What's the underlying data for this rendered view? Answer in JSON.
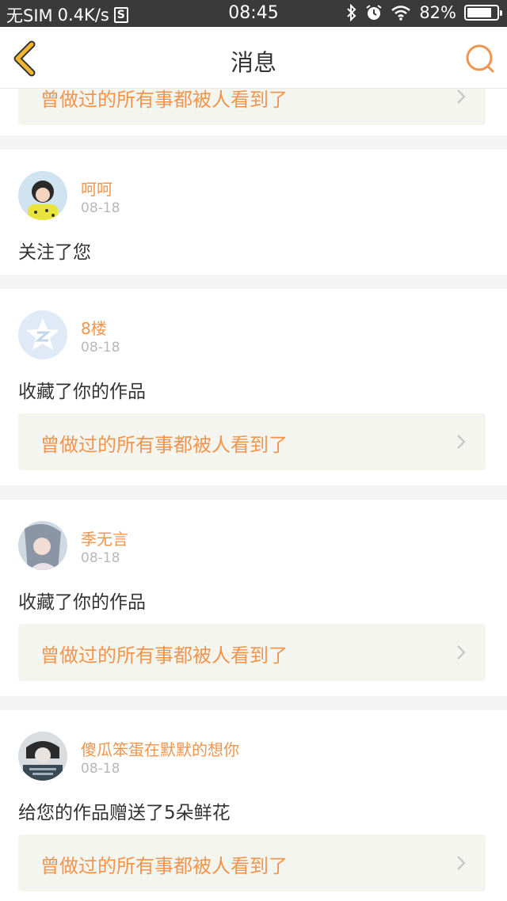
{
  "status_bar": {
    "carrier": "无SIM",
    "speed": "0.4K/s",
    "sim_icon": "S",
    "time": "08:45",
    "battery": "82%",
    "battery_level": 0.82
  },
  "nav": {
    "title": "消息"
  },
  "notifications": [
    {
      "link_text": "曾做过的所有事都被人看到了"
    },
    {
      "user": "呵呵",
      "date": "08-18",
      "action": "关注了您"
    },
    {
      "user": "8楼",
      "date": "08-18",
      "action": "收藏了你的作品",
      "link_text": "曾做过的所有事都被人看到了"
    },
    {
      "user": "季无言",
      "date": "08-18",
      "action": "收藏了你的作品",
      "link_text": "曾做过的所有事都被人看到了"
    },
    {
      "user": "傻瓜笨蛋在默默的想你",
      "date": "08-18",
      "action": "给您的作品赠送了5朵鲜花",
      "link_text": "曾做过的所有事都被人看到了"
    }
  ],
  "colors": {
    "accent": "#f0954e",
    "back_arrow": "#f2b632",
    "link_bg": "#f5f5ef",
    "page_bg": "#f4f4f4",
    "status_bar": "#3a3a3a"
  }
}
